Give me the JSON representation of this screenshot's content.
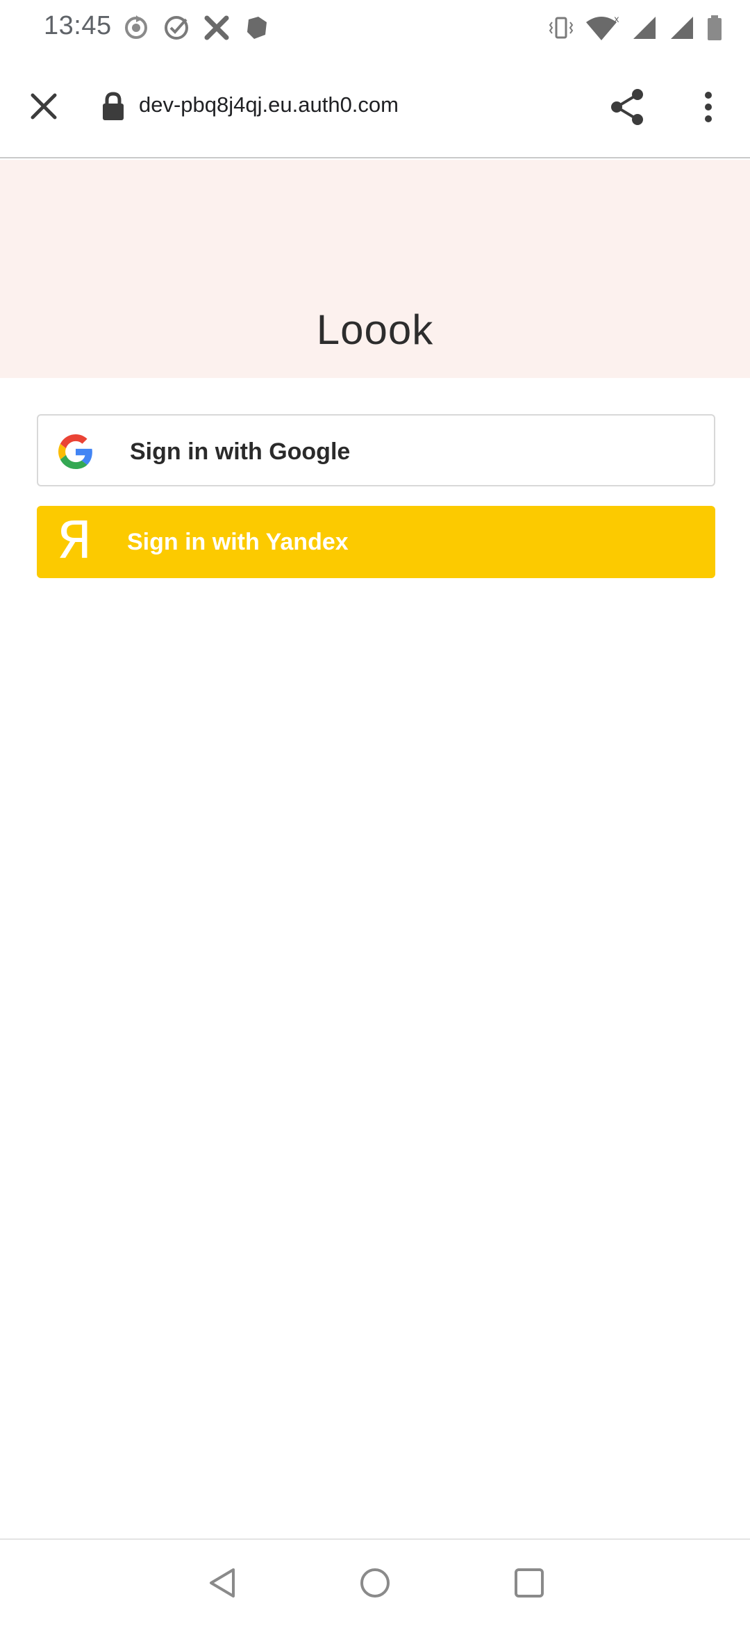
{
  "status_bar": {
    "time": "13:45",
    "left_icons": [
      "sync-icon",
      "check-circle-icon",
      "tools-icon",
      "shield-icon"
    ],
    "right_icons": [
      "vibrate-icon",
      "wifi-icon",
      "signal-icon",
      "signal-icon",
      "battery-icon"
    ],
    "wifi_badge": "x"
  },
  "toolbar": {
    "url": "dev-pbq8j4qj.eu.auth0.com",
    "close_icon": "close-icon",
    "lock_icon": "lock-icon",
    "share_icon": "share-icon",
    "menu_icon": "more-vert-icon"
  },
  "banner": {
    "title": "Loook",
    "background": "#fcf1ee"
  },
  "buttons": {
    "google": {
      "label": "Sign in with Google",
      "icon": "google-icon"
    },
    "yandex": {
      "label": "Sign in with Yandex",
      "icon": "yandex-icon",
      "glyph": "Я",
      "color": "#fcca00"
    }
  },
  "nav_bar": {
    "icons": [
      "back-icon",
      "home-icon",
      "recents-icon"
    ]
  }
}
